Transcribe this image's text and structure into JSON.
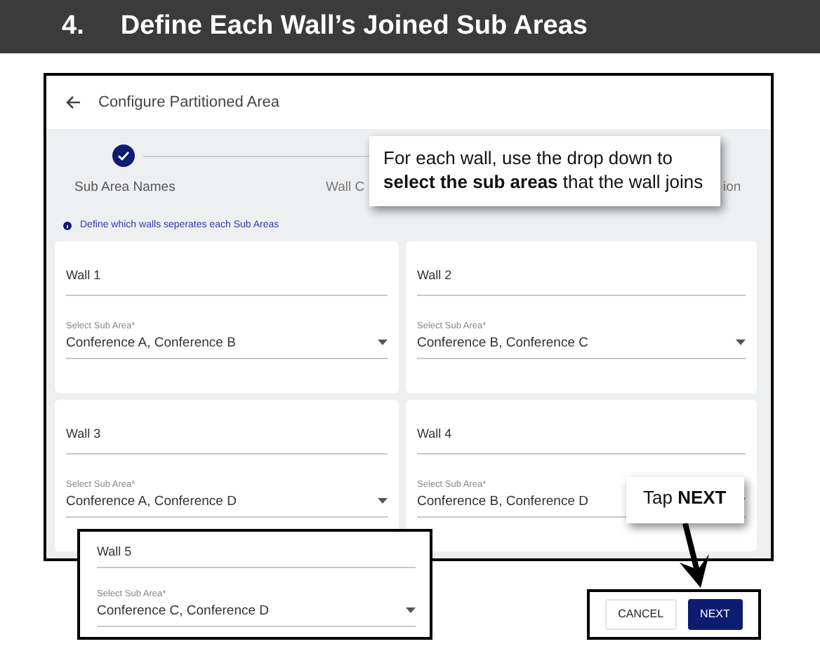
{
  "heading": {
    "number": "4.",
    "title": "Define Each Wall’s Joined Sub Areas"
  },
  "screen": {
    "title": "Configure Partitioned Area",
    "steps": [
      {
        "label": "Sub Area Names",
        "done": true
      },
      {
        "label": "Wall C",
        "done": false
      },
      {
        "label": "ion",
        "done": false
      }
    ],
    "info": "Define which walls seperates each Sub Areas",
    "walls": [
      {
        "name": "Wall 1",
        "select_label": "Select Sub Area*",
        "value": "Conference A, Conference B"
      },
      {
        "name": "Wall 2",
        "select_label": "Select Sub Area*",
        "value": "Conference B, Conference C"
      },
      {
        "name": "Wall 3",
        "select_label": "Select Sub Area*",
        "value": "Conference A, Conference D"
      },
      {
        "name": "Wall 4",
        "select_label": "Select Sub Area*",
        "value": "Conference B, Conference D"
      }
    ]
  },
  "wall_inset": {
    "name": "Wall 5",
    "select_label": "Select Sub Area*",
    "value": "Conference C, Conference D"
  },
  "callouts": [
    {
      "text": "For each wall, use the drop down to **select the sub areas** that the wall joins"
    },
    {
      "text": "Tap **NEXT**"
    }
  ],
  "buttons": [
    {
      "label": "CANCEL",
      "kind": "secondary"
    },
    {
      "label": "NEXT",
      "kind": "primary"
    }
  ]
}
